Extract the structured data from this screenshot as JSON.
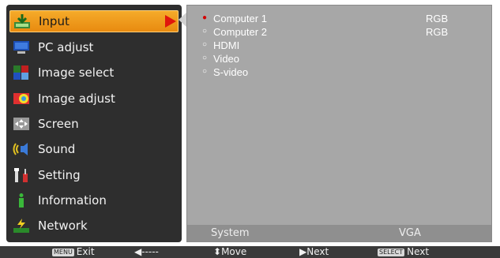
{
  "menu": {
    "items": [
      {
        "label": "Input",
        "icon": "input-icon"
      },
      {
        "label": "PC adjust",
        "icon": "monitor-icon"
      },
      {
        "label": "Image select",
        "icon": "image-select-icon"
      },
      {
        "label": "Image adjust",
        "icon": "image-adjust-icon"
      },
      {
        "label": "Screen",
        "icon": "screen-icon"
      },
      {
        "label": "Sound",
        "icon": "speaker-icon"
      },
      {
        "label": "Setting",
        "icon": "wrench-icon"
      },
      {
        "label": "Information",
        "icon": "info-icon"
      },
      {
        "label": "Network",
        "icon": "network-icon"
      }
    ],
    "selected": "Input"
  },
  "inputs": [
    {
      "name": "Computer 1",
      "signal": "RGB",
      "selected": true
    },
    {
      "name": "Computer 2",
      "signal": "RGB",
      "selected": false
    },
    {
      "name": "HDMI",
      "signal": "",
      "selected": false
    },
    {
      "name": "Video",
      "signal": "",
      "selected": false
    },
    {
      "name": "S-video",
      "signal": "",
      "selected": false
    }
  ],
  "status": {
    "label": "System",
    "value": "VGA"
  },
  "footer": {
    "exit_key": "MENU",
    "exit_label": "Exit",
    "back_label": "◀-----",
    "move_label": "Move",
    "next_label": "▶Next",
    "select_key": "SELECT",
    "select_label": "Next"
  },
  "colors": {
    "accent": "#f0a020",
    "selected_bullet": "#d40000",
    "pointer_arrow": "#e0160c"
  }
}
